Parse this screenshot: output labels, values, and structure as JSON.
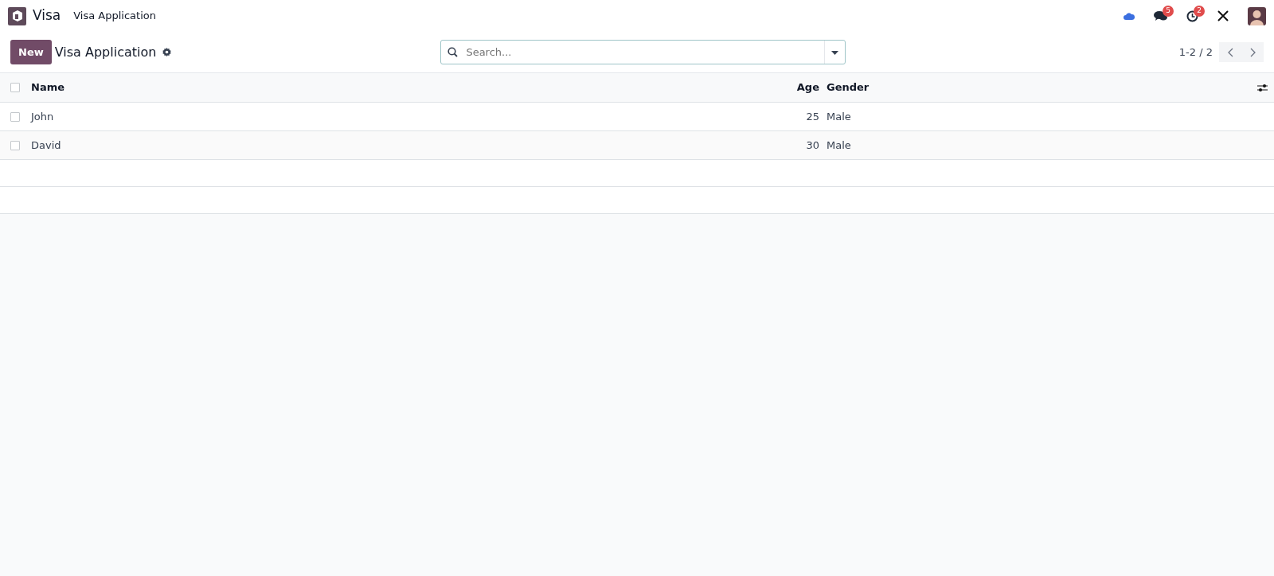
{
  "navbar": {
    "app_name": "Visa",
    "menu": [
      "Visa Application"
    ],
    "notifications": [
      {
        "kind": "chat",
        "count": "5"
      },
      {
        "kind": "activity",
        "count": "2"
      }
    ]
  },
  "control_panel": {
    "new_button": "New",
    "title": "Visa Application",
    "search": {
      "placeholder": "Search..."
    },
    "pager": "1-2 / 2"
  },
  "table": {
    "select_all": {
      "selected": false
    },
    "columns": [
      "Name",
      "Age",
      "Gender"
    ],
    "rows": [
      {
        "name": "John",
        "age": "25",
        "gender": "Male",
        "selected": false
      },
      {
        "name": "David",
        "age": "30",
        "gender": "Male",
        "selected": false
      }
    ]
  }
}
